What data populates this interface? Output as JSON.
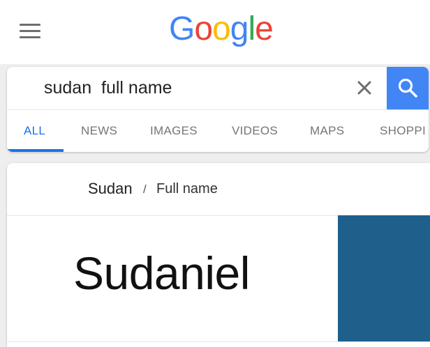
{
  "header": {
    "menu_icon": "hamburger-menu-icon",
    "logo_letters": [
      {
        "char": "G",
        "color": "#4285F4"
      },
      {
        "char": "o",
        "color": "#EA4335"
      },
      {
        "char": "o",
        "color": "#FBBC05"
      },
      {
        "char": "g",
        "color": "#4285F4"
      },
      {
        "char": "l",
        "color": "#34A853"
      },
      {
        "char": "e",
        "color": "#EA4335"
      }
    ]
  },
  "search": {
    "query": "sudan  full name",
    "clear_icon": "close-icon",
    "search_icon": "search-icon",
    "button_color": "#4285F4"
  },
  "tabs": [
    {
      "label": "ALL",
      "active": true
    },
    {
      "label": "NEWS",
      "active": false
    },
    {
      "label": "IMAGES",
      "active": false
    },
    {
      "label": "VIDEOS",
      "active": false
    },
    {
      "label": "MAPS",
      "active": false
    },
    {
      "label": "SHOPPI",
      "active": false
    }
  ],
  "result": {
    "entity": "Sudan",
    "separator": "/",
    "attribute": "Full name",
    "answer": "Sudaniel",
    "image_color": "#1F5F8B"
  },
  "colors": {
    "accent": "#1A73E8",
    "tab_inactive": "#757575"
  }
}
